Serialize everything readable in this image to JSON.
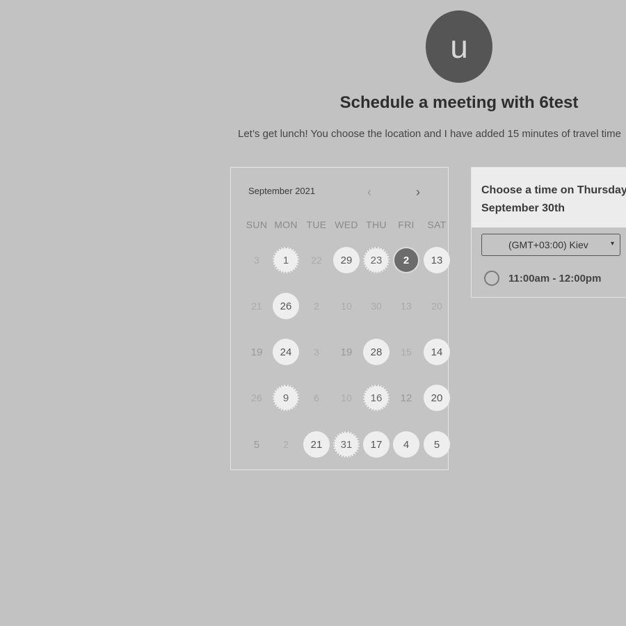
{
  "host": {
    "avatar_letter": "u",
    "title": "Schedule a meeting with 6test",
    "description": "Let’s get lunch! You choose the location and I have added 15 minutes of travel time"
  },
  "calendar": {
    "month_label": "September 2021",
    "prev_icon": "‹",
    "next_icon": "›",
    "weekdays": [
      "SUN",
      "MON",
      "TUE",
      "WED",
      "THU",
      "FRI",
      "SAT"
    ],
    "weeks": [
      [
        {
          "label": "3",
          "state": "muted"
        },
        {
          "label": "1",
          "state": "dotted"
        },
        {
          "label": "22",
          "state": "muted"
        },
        {
          "label": "29",
          "state": "available"
        },
        {
          "label": "23",
          "state": "dotted"
        },
        {
          "label": "2",
          "state": "selected"
        },
        {
          "label": "13",
          "state": "available"
        }
      ],
      [
        {
          "label": "21",
          "state": "muted"
        },
        {
          "label": "26",
          "state": "available"
        },
        {
          "label": "2",
          "state": "muted"
        },
        {
          "label": "10",
          "state": "muted"
        },
        {
          "label": "30",
          "state": "muted"
        },
        {
          "label": "13",
          "state": "muted"
        },
        {
          "label": "20",
          "state": "muted"
        }
      ],
      [
        {
          "label": "19",
          "state": "plain"
        },
        {
          "label": "24",
          "state": "available"
        },
        {
          "label": "3",
          "state": "muted"
        },
        {
          "label": "19",
          "state": "plain"
        },
        {
          "label": "28",
          "state": "available"
        },
        {
          "label": "15",
          "state": "muted"
        },
        {
          "label": "14",
          "state": "available"
        }
      ],
      [
        {
          "label": "26",
          "state": "muted"
        },
        {
          "label": "9",
          "state": "dotted"
        },
        {
          "label": "6",
          "state": "muted"
        },
        {
          "label": "10",
          "state": "muted"
        },
        {
          "label": "16",
          "state": "dotted"
        },
        {
          "label": "12",
          "state": "plain"
        },
        {
          "label": "20",
          "state": "available"
        }
      ],
      [
        {
          "label": "5",
          "state": "plain"
        },
        {
          "label": "2",
          "state": "muted"
        },
        {
          "label": "21",
          "state": "available"
        },
        {
          "label": "31",
          "state": "dotted"
        },
        {
          "label": "17",
          "state": "available"
        },
        {
          "label": "4",
          "state": "available"
        },
        {
          "label": "5",
          "state": "available"
        }
      ]
    ]
  },
  "times": {
    "heading": "Choose a time on Thursday, September 30th",
    "timezone": "(GMT+03:00) Kiev",
    "caret_icon": "▾",
    "slots": [
      {
        "label": "11:00am - 12:00pm"
      }
    ]
  }
}
